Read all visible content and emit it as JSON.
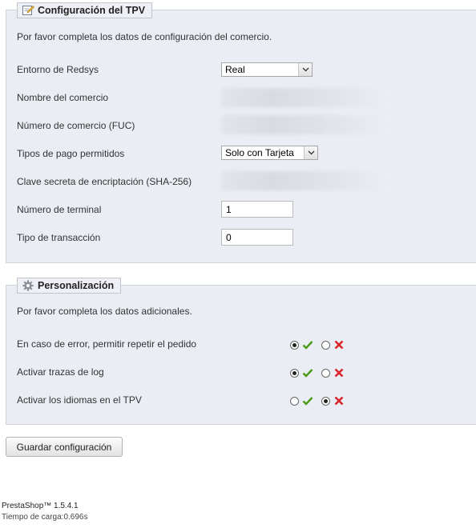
{
  "config_section": {
    "title": "Configuración del TPV",
    "intro": "Por favor completa los datos de configuración del comercio.",
    "fields": {
      "environment": {
        "label": "Entorno de Redsys",
        "value": "Real"
      },
      "merchant_name": {
        "label": "Nombre del comercio"
      },
      "merchant_number": {
        "label": "Número de comercio (FUC)"
      },
      "payment_types": {
        "label": "Tipos de pago permitidos",
        "value": "Solo con Tarjeta"
      },
      "secret_key": {
        "label": "Clave secreta de encriptación (SHA-256)"
      },
      "terminal_number": {
        "label": "Número de terminal",
        "value": "1"
      },
      "transaction_type": {
        "label": "Tipo de transacción",
        "value": "0"
      }
    }
  },
  "custom_section": {
    "title": "Personalización",
    "intro": "Por favor completa los datos adicionales.",
    "options": [
      {
        "label": "En caso de error, permitir repetir el pedido",
        "selected": "yes"
      },
      {
        "label": "Activar trazas de log",
        "selected": "yes"
      },
      {
        "label": "Activar los idiomas en el TPV",
        "selected": "no"
      }
    ]
  },
  "save_button": "Guardar configuración",
  "footer": {
    "version": "PrestaShop™ 1.5.4.1",
    "load_time": "Tiempo de carga:0.696s"
  },
  "colors": {
    "panel_bg": "#ebedf4",
    "check_green": "#4a9a1a",
    "cross_red": "#d9262a"
  }
}
